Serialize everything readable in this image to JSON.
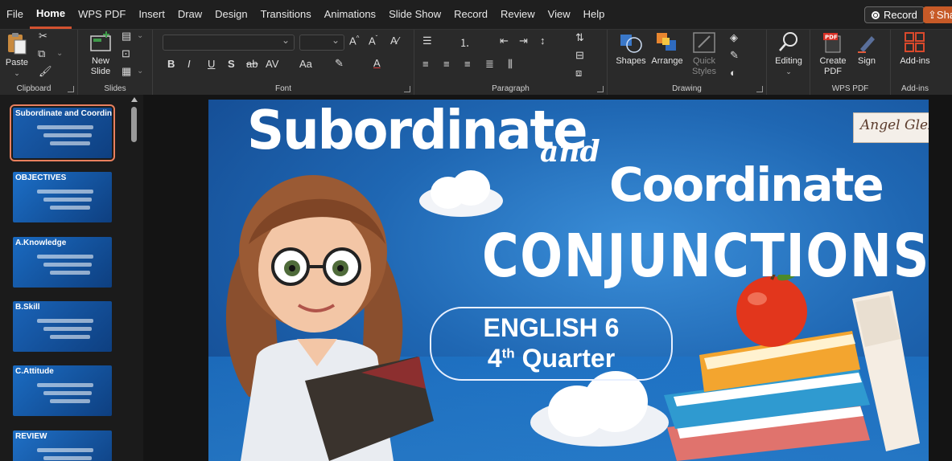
{
  "menu": {
    "items": [
      {
        "label": "File",
        "name": "menu-file"
      },
      {
        "label": "Home",
        "name": "menu-home",
        "active": true
      },
      {
        "label": "WPS PDF",
        "name": "menu-wps-pdf"
      },
      {
        "label": "Insert",
        "name": "menu-insert"
      },
      {
        "label": "Draw",
        "name": "menu-draw"
      },
      {
        "label": "Design",
        "name": "menu-design"
      },
      {
        "label": "Transitions",
        "name": "menu-transitions"
      },
      {
        "label": "Animations",
        "name": "menu-animations"
      },
      {
        "label": "Slide Show",
        "name": "menu-slide-show"
      },
      {
        "label": "Record",
        "name": "menu-record"
      },
      {
        "label": "Review",
        "name": "menu-review"
      },
      {
        "label": "View",
        "name": "menu-view"
      },
      {
        "label": "Help",
        "name": "menu-help"
      }
    ],
    "record_button": "Record",
    "share_button": "Share"
  },
  "ribbon": {
    "clipboard": {
      "paste": "Paste",
      "group_label": "Clipboard"
    },
    "slides": {
      "new_slide": "New Slide",
      "group_label": "Slides"
    },
    "font": {
      "group_label": "Font",
      "font_name": "",
      "font_size": ""
    },
    "paragraph": {
      "group_label": "Paragraph"
    },
    "drawing": {
      "shapes": "Shapes",
      "arrange": "Arrange",
      "quick_styles": "Quick Styles",
      "group_label": "Drawing"
    },
    "editing": {
      "label": "Editing"
    },
    "wps_pdf": {
      "create_pdf": "Create PDF",
      "sign": "Sign",
      "group_label": "WPS PDF",
      "pdf_badge": "PDF"
    },
    "addins": {
      "label": "Add-ins",
      "group_label": "Add-ins"
    }
  },
  "thumbnails": [
    {
      "title": "Subordinate and Coordinate CONJUNCTIONS",
      "color": "#1a5fb0"
    },
    {
      "title": "OBJECTIVES",
      "color": "#1c6fc7"
    },
    {
      "title": "A.Knowledge",
      "color": "#1a6ac0"
    },
    {
      "title": "B.Skill",
      "color": "#1a64b8"
    },
    {
      "title": "C.Attitude",
      "color": "#1b6cc2"
    },
    {
      "title": "REVIEW",
      "color": "#1f70c6"
    }
  ],
  "slide": {
    "title_line1": "Subordinate",
    "title_and": "and",
    "title_line2": "Coordinate",
    "title_line3": "CONJUNCTIONS",
    "badge_line1": "ENGLISH 6",
    "badge_num": "4",
    "badge_sup": "th",
    "badge_rest": " Quarter",
    "logo_text": "Angel Glez"
  },
  "colors": {
    "accent": "#d35230",
    "share": "#c75a27",
    "selected_thumb": "#e9805e",
    "slide_blue": "#1f67b3"
  }
}
